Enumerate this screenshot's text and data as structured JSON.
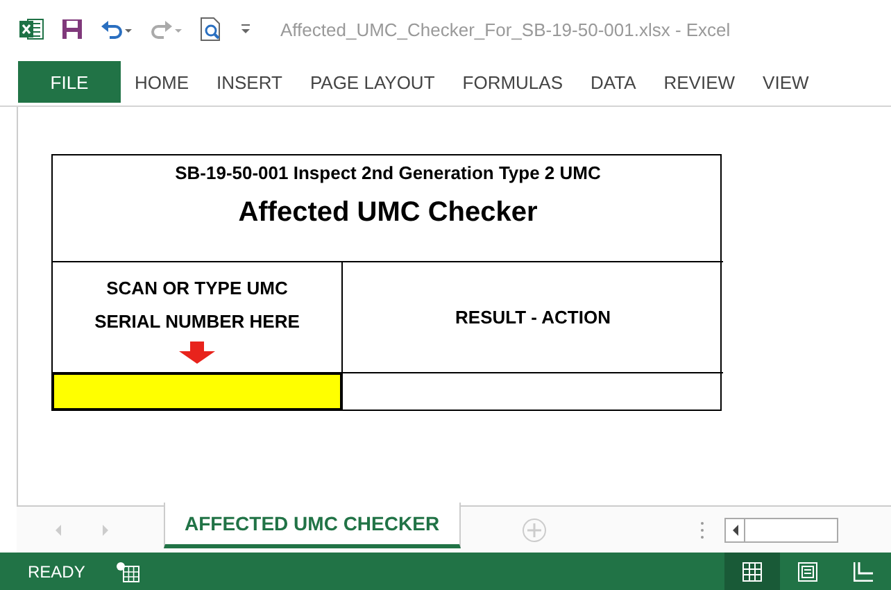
{
  "window": {
    "title": "Affected_UMC_Checker_For_SB-19-50-001.xlsx - Excel"
  },
  "ribbon": {
    "file_tab": "FILE",
    "tabs": [
      {
        "label": "HOME",
        "selected": false
      },
      {
        "label": "INSERT",
        "selected": false
      },
      {
        "label": "PAGE LAYOUT",
        "selected": false
      },
      {
        "label": "FORMULAS",
        "selected": false
      },
      {
        "label": "DATA",
        "selected": false
      },
      {
        "label": "REVIEW",
        "selected": false
      },
      {
        "label": "VIEW",
        "selected": false
      }
    ]
  },
  "sheet": {
    "subtitle": "SB-19-50-001 Inspect 2nd Generation Type 2 UMC",
    "title": "Affected UMC Checker",
    "input_header": "SCAN OR TYPE UMC\nSERIAL NUMBER HERE",
    "result_header": "RESULT - ACTION"
  },
  "sheet_tabs": [
    {
      "label": "AFFECTED UMC CHECKER",
      "selected": true
    }
  ],
  "status_bar": {
    "status": "READY",
    "views": [
      {
        "kind": "normal",
        "selected": true
      },
      {
        "kind": "page-layout",
        "selected": false
      },
      {
        "kind": "page-break",
        "selected": false
      }
    ]
  }
}
